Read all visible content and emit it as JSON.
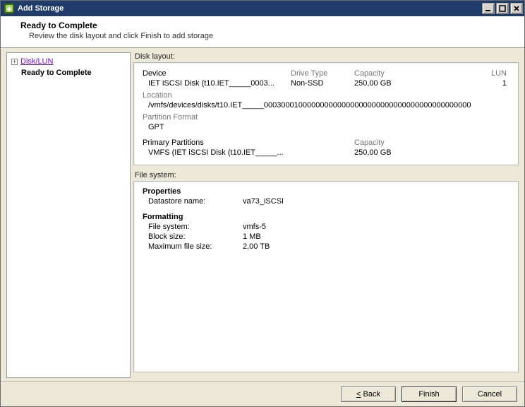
{
  "titlebar": {
    "title": "Add Storage",
    "minimize": "Minimize",
    "maximize": "Maximize",
    "close": "Close"
  },
  "header": {
    "title": "Ready to Complete",
    "subtitle": "Review the disk layout and click Finish to add storage"
  },
  "nav": {
    "disk_lun": "Disk/LUN",
    "ready": "Ready to Complete"
  },
  "disk_layout": {
    "label": "Disk layout:",
    "cols": {
      "device": "Device",
      "drivetype": "Drive Type",
      "capacity": "Capacity",
      "lun": "LUN"
    },
    "row": {
      "device": "IET iSCSI Disk (t10.IET_____0003...",
      "drivetype": "Non-SSD",
      "capacity": "250,00 GB",
      "lun": "1"
    },
    "location_label": "Location",
    "location_value": "/vmfs/devices/disks/t10.IET_____000300010000000000000000000000000000000000000000",
    "partition_format_label": "Partition Format",
    "partition_format_value": "GPT",
    "primary_partitions": {
      "label": "Primary Partitions",
      "capacity_label": "Capacity",
      "row": {
        "name": "VMFS (IET iSCSI Disk (t10.IET_____...",
        "capacity": "250,00 GB"
      }
    }
  },
  "file_system": {
    "label": "File system:",
    "properties": {
      "heading": "Properties",
      "datastore_name_label": "Datastore name:",
      "datastore_name_value": "va73_iSCSI"
    },
    "formatting": {
      "heading": "Formatting",
      "fs_label": "File system:",
      "fs_value": "vmfs-5",
      "block_label": "Block size:",
      "block_value": "1 MB",
      "maxfile_label": "Maximum file size:",
      "maxfile_value": "2,00 TB"
    }
  },
  "buttons": {
    "back": "Back",
    "finish": "Finish",
    "cancel": "Cancel"
  }
}
